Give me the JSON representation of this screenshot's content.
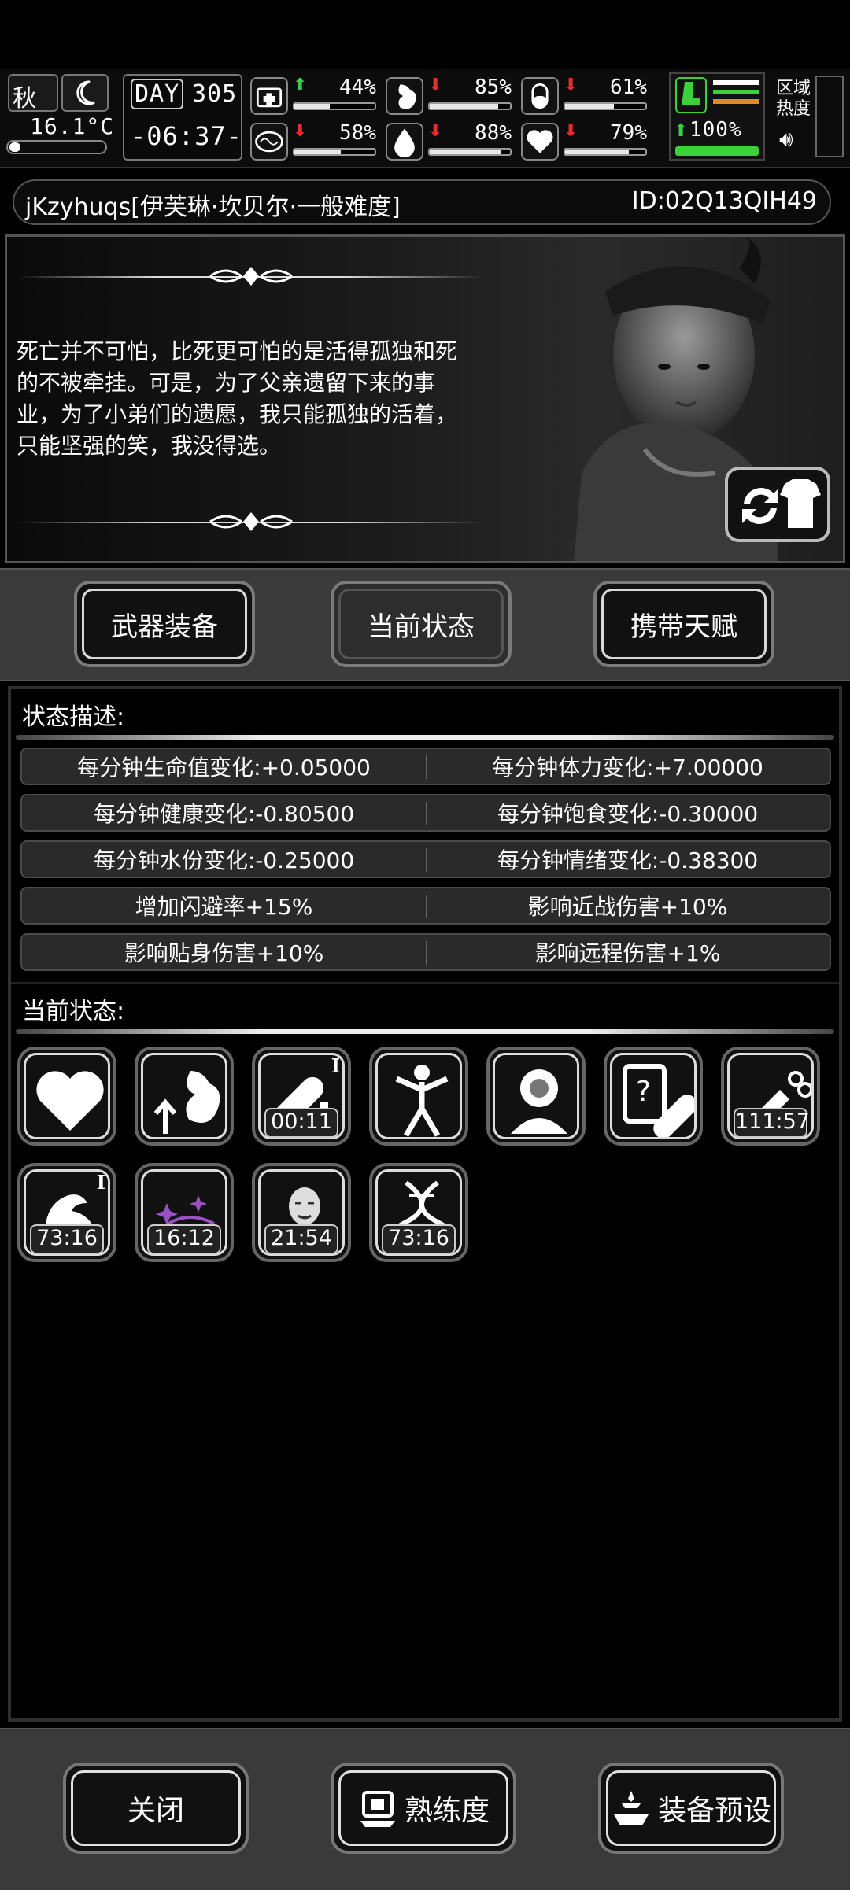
{
  "status_bar": {
    "season": "秋",
    "temperature": "16.1°C",
    "day_label": "DAY",
    "day_number": "305",
    "clock": "-06:37-",
    "region_heat_label": "区域热度",
    "stats": [
      {
        "icon": "medkit-icon",
        "trend": "up",
        "value": "44%",
        "fill": 0.44
      },
      {
        "icon": "stomach-icon",
        "trend": "down",
        "value": "85%",
        "fill": 0.85
      },
      {
        "icon": "pill-icon",
        "trend": "down",
        "value": "61%",
        "fill": 0.61
      },
      {
        "icon": "brain-icon",
        "trend": "down",
        "value": "58%",
        "fill": 0.58
      },
      {
        "icon": "water-drop-icon",
        "trend": "down",
        "value": "88%",
        "fill": 0.88
      },
      {
        "icon": "heart-icon",
        "trend": "down",
        "value": "79%",
        "fill": 0.79
      }
    ],
    "stamina": {
      "icon": "boot-icon",
      "trend": "up",
      "value": "100%",
      "fill": 1.0
    },
    "colors": {
      "up": "#34d04a",
      "down": "#e23030",
      "stamina_green": "#3bd13b",
      "stamina_orange": "#e08a2a"
    }
  },
  "character": {
    "title": "jKzyhuqs[伊芙琳·坎贝尔·一般难度]",
    "id": "ID:02Q13QIH49",
    "quote": "死亡并不可怕，比死更可怕的是活得孤独和死的不被牵挂。可是，为了父亲遗留下来的事业，为了小弟们的遗愿，我只能孤独的活着，只能坚强的笑，我没得选。"
  },
  "tabs": [
    {
      "label": "武器装备",
      "active": false
    },
    {
      "label": "当前状态",
      "active": true
    },
    {
      "label": "携带天赋",
      "active": false
    }
  ],
  "status_description": {
    "heading": "状态描述:",
    "rows": [
      [
        "每分钟生命值变化:+0.05000",
        "每分钟体力变化:+7.00000"
      ],
      [
        "每分钟健康变化:-0.80500",
        "每分钟饱食变化:-0.30000"
      ],
      [
        "每分钟水份变化:-0.25000",
        "每分钟情绪变化:-0.38300"
      ],
      [
        "增加闪避率+15%",
        "影响近战伤害+10%"
      ],
      [
        "影响贴身伤害+10%",
        "影响远程伤害+1%"
      ]
    ]
  },
  "current_status": {
    "heading": "当前状态:",
    "icons": [
      {
        "name": "heart-icon",
        "timer": "",
        "roman": ""
      },
      {
        "name": "stomach-arrow-icon",
        "timer": "",
        "roman": ""
      },
      {
        "name": "pill-plus-icon",
        "timer": "00:11",
        "roman": "I"
      },
      {
        "name": "stick-figure-icon",
        "timer": "",
        "roman": ""
      },
      {
        "name": "head-brain-icon",
        "timer": "",
        "roman": ""
      },
      {
        "name": "clipboard-pill-icon",
        "timer": "",
        "roman": ""
      },
      {
        "name": "syringe-scissors-icon",
        "timer": "111:57",
        "roman": ""
      },
      {
        "name": "flexed-arm-icon",
        "timer": "73:16",
        "roman": "I"
      },
      {
        "name": "purple-sparkle-icon",
        "timer": "16:12",
        "roman": ""
      },
      {
        "name": "old-man-face-icon",
        "timer": "21:54",
        "roman": ""
      },
      {
        "name": "dna-helix-icon",
        "timer": "73:16",
        "roman": ""
      }
    ]
  },
  "bottom_buttons": [
    {
      "label": "关闭",
      "icon": ""
    },
    {
      "label": "熟练度",
      "icon": "trophy-stand-icon"
    },
    {
      "label": "装备预设",
      "icon": "gear-tray-icon"
    }
  ]
}
